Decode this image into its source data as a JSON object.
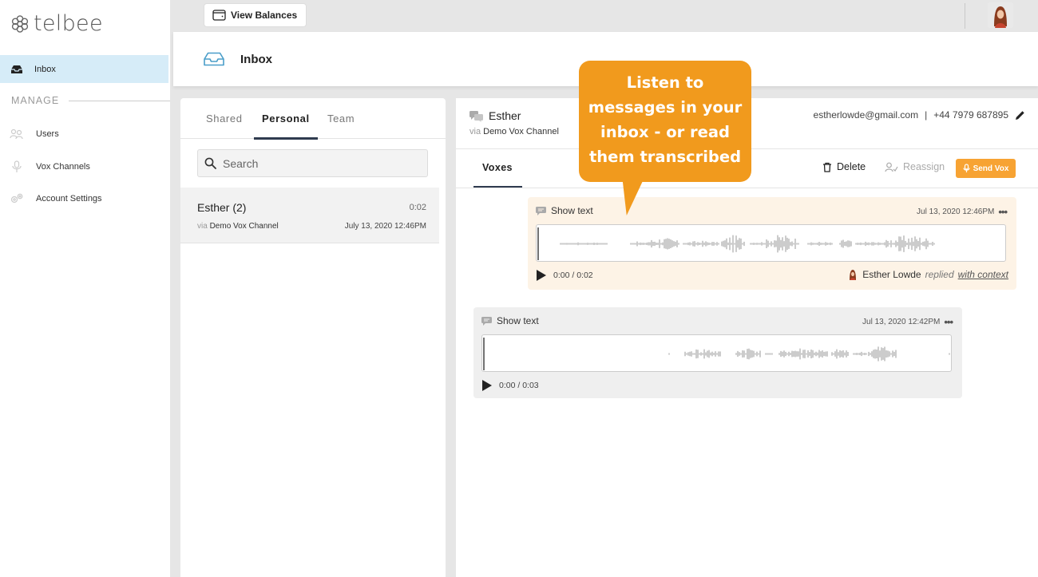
{
  "brand": {
    "name": "telbee"
  },
  "sidebar": {
    "inbox_label": "Inbox",
    "section_label": "MANAGE",
    "items": [
      {
        "label": "Users",
        "icon": "users-icon"
      },
      {
        "label": "Vox Channels",
        "icon": "microphone-icon"
      },
      {
        "label": "Account Settings",
        "icon": "gears-icon"
      }
    ]
  },
  "topbar": {
    "view_balances": "View Balances"
  },
  "header": {
    "title": "Inbox"
  },
  "inbox": {
    "tabs": [
      "Shared",
      "Personal",
      "Team"
    ],
    "active_tab": "Personal",
    "search_placeholder": "Search",
    "conversations": [
      {
        "name": "Esther (2)",
        "duration": "0:02",
        "via": "via",
        "channel": "Demo Vox Channel",
        "date": "July 13, 2020 12:46PM"
      }
    ]
  },
  "conversation": {
    "contact_name": "Esther",
    "via": "via",
    "channel": "Demo Vox Channel",
    "email": "estherlowde@gmail.com",
    "separator": "|",
    "phone": "+44 7979 687895",
    "tab": "Voxes",
    "actions": {
      "delete": "Delete",
      "reassign": "Reassign",
      "send": "Send Vox"
    },
    "voxes": [
      {
        "show_text": "Show text",
        "date": "Jul 13, 2020 12:46PM",
        "time": "0:00 / 0:02",
        "replied_by": "Esther Lowde",
        "replied_word": "replied",
        "context_link": "with context"
      },
      {
        "show_text": "Show text",
        "date": "Jul 13, 2020 12:42PM",
        "time": "0:00 / 0:03"
      }
    ]
  },
  "callout": {
    "lines": [
      "Listen to",
      "messages in your",
      "inbox - or read",
      "them transcribed"
    ]
  },
  "colors": {
    "accent_orange": "#f19a1d",
    "send_button": "#f7a333",
    "inbox_highlight": "#d6ecf8",
    "tab_underline": "#2f3b4f"
  }
}
